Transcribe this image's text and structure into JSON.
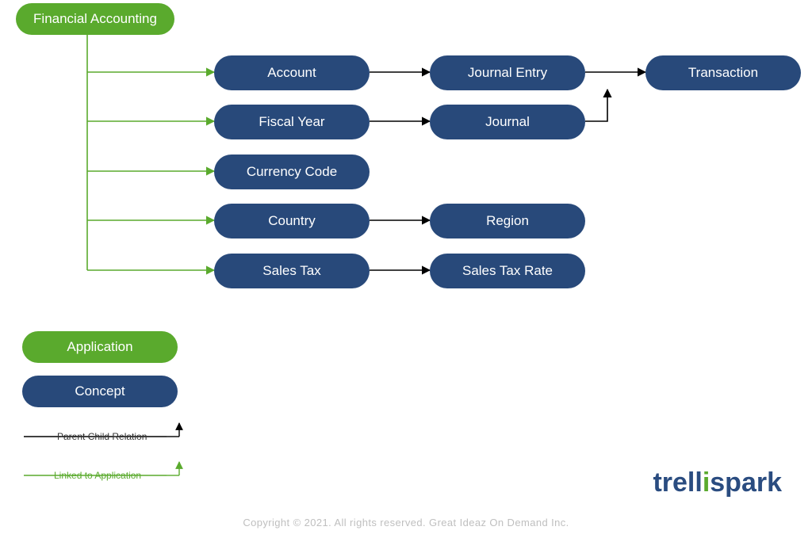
{
  "root": {
    "label": "Financial Accounting"
  },
  "nodes": {
    "account": "Account",
    "journal_entry": "Journal Entry",
    "transaction": "Transaction",
    "fiscal_year": "Fiscal Year",
    "journal": "Journal",
    "currency_code": "Currency Code",
    "country": "Country",
    "region": "Region",
    "sales_tax": "Sales Tax",
    "sales_tax_rate": "Sales Tax Rate"
  },
  "legend": {
    "application": "Application",
    "concept": "Concept",
    "parent_child": "Parent Child Relation",
    "linked_to_application": "Linked to Application"
  },
  "copyright": "Copyright © 2021. All rights reserved. Great Ideaz On Demand Inc.",
  "logo": {
    "part1": "trell",
    "part2": "i",
    "part3": "spark"
  },
  "colors": {
    "green": "#5aaa2d",
    "navy": "#28497a"
  }
}
